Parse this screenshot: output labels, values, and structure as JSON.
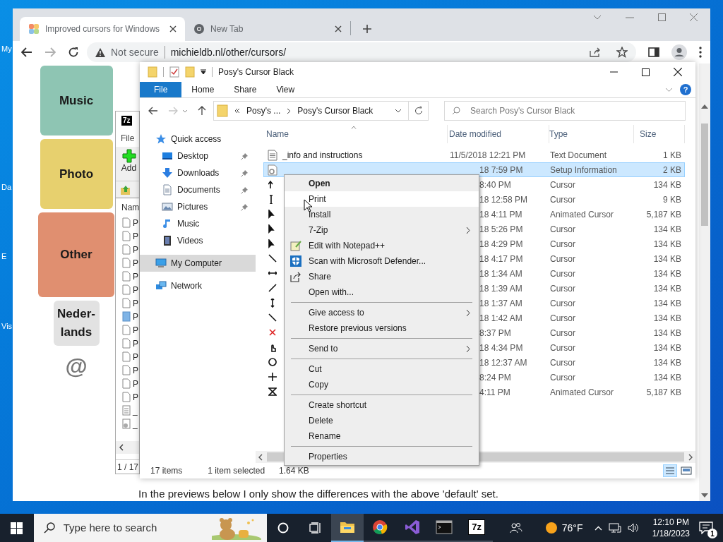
{
  "desktop_icons": [
    {
      "label": "My"
    },
    {
      "label": "Da"
    },
    {
      "label": "E"
    },
    {
      "label": "Vis"
    }
  ],
  "browser": {
    "tabs": [
      {
        "title": "Improved cursors for Windows",
        "selected": true
      },
      {
        "title": "New Tab",
        "selected": false
      }
    ],
    "security": "Not secure",
    "url": "michieldb.nl/other/cursors/"
  },
  "page": {
    "tiles": [
      {
        "label": "Music",
        "color": "#8ec5b3"
      },
      {
        "label": "Photo",
        "color": "#e7d06e"
      },
      {
        "label": "Other",
        "color": "#e08f70"
      },
      {
        "label": "Neder-lands",
        "color": "#e2e2e2"
      }
    ],
    "at": "@",
    "text": "In the previews below I only show the differences with the above 'default' set."
  },
  "sevenzip": {
    "logo": "7z",
    "menu": "File",
    "add": "Add",
    "column": "Nam",
    "rows": [
      {
        "name": "P",
        "kind": "file"
      },
      {
        "name": "P",
        "kind": "file"
      },
      {
        "name": "P",
        "kind": "file"
      },
      {
        "name": "P",
        "kind": "file"
      },
      {
        "name": "P",
        "kind": "file"
      },
      {
        "name": "P",
        "kind": "file"
      },
      {
        "name": "P",
        "kind": "file"
      },
      {
        "name": "P",
        "kind": "marked"
      },
      {
        "name": "P",
        "kind": "file"
      },
      {
        "name": "P",
        "kind": "file"
      },
      {
        "name": "P",
        "kind": "file"
      },
      {
        "name": "P",
        "kind": "file"
      },
      {
        "name": "P",
        "kind": "file"
      },
      {
        "name": "P",
        "kind": "file"
      },
      {
        "name": "_",
        "kind": "text"
      },
      {
        "name": "_",
        "kind": "setup"
      }
    ],
    "status": "1 / 17"
  },
  "explorer": {
    "title": "Posy's Cursor Black",
    "ribbon_tabs": [
      {
        "label": "File",
        "selected": true
      },
      {
        "label": "Home",
        "selected": false
      },
      {
        "label": "Share",
        "selected": false
      },
      {
        "label": "View",
        "selected": false
      }
    ],
    "help": "?",
    "breadcrumbs": [
      "Posy's ...",
      "Posy's Cursor Black"
    ],
    "search_placeholder": "Search Posy's Cursor Black",
    "nav": [
      {
        "label": "Quick access",
        "selected": false,
        "children": [
          {
            "label": "Desktop",
            "pinned": true,
            "selected": false
          },
          {
            "label": "Downloads",
            "pinned": true,
            "selected": false
          },
          {
            "label": "Documents",
            "pinned": true,
            "selected": false
          },
          {
            "label": "Pictures",
            "pinned": true,
            "selected": false
          },
          {
            "label": "Music",
            "pinned": false,
            "selected": false
          },
          {
            "label": "Videos",
            "pinned": false,
            "selected": false
          }
        ]
      },
      {
        "label": "My Computer",
        "selected": true
      },
      {
        "label": "Network",
        "selected": false
      }
    ],
    "columns": [
      "Name",
      "Date modified",
      "Type",
      "Size"
    ],
    "rows": [
      {
        "kind": "text",
        "name": "_info and instructions",
        "date": "11/5/2018 12:21 PM",
        "type": "Text Document",
        "size": "1 KB",
        "selected": false,
        "covered": false
      },
      {
        "kind": "setup",
        "date": "18 7:59 PM",
        "type": "Setup Information",
        "size": "2 KB",
        "selected": true,
        "covered": true
      },
      {
        "kind": "cursor",
        "date": "8:40 PM",
        "type": "Cursor",
        "size": "134 KB",
        "selected": false,
        "covered": true
      },
      {
        "kind": "cursor",
        "date": "18 12:58 PM",
        "type": "Cursor",
        "size": "9 KB",
        "selected": false,
        "covered": true
      },
      {
        "kind": "cursor",
        "date": "18 4:11 PM",
        "type": "Animated Cursor",
        "size": "5,187 KB",
        "selected": false,
        "covered": true
      },
      {
        "kind": "cursor",
        "date": "18 5:26 PM",
        "type": "Cursor",
        "size": "134 KB",
        "selected": false,
        "covered": true
      },
      {
        "kind": "cursor",
        "date": "18 4:29 PM",
        "type": "Cursor",
        "size": "134 KB",
        "selected": false,
        "covered": true
      },
      {
        "kind": "cursor",
        "date": "18 4:17 PM",
        "type": "Cursor",
        "size": "134 KB",
        "selected": false,
        "covered": true
      },
      {
        "kind": "cursor",
        "date": "18 1:34 AM",
        "type": "Cursor",
        "size": "134 KB",
        "selected": false,
        "covered": true
      },
      {
        "kind": "cursor",
        "date": "18 1:39 AM",
        "type": "Cursor",
        "size": "134 KB",
        "selected": false,
        "covered": true
      },
      {
        "kind": "cursor",
        "date": "18 1:37 AM",
        "type": "Cursor",
        "size": "134 KB",
        "selected": false,
        "covered": true
      },
      {
        "kind": "cursor",
        "date": "18 1:42 AM",
        "type": "Cursor",
        "size": "134 KB",
        "selected": false,
        "covered": true
      },
      {
        "kind": "cursor",
        "date": "8:37 PM",
        "type": "Cursor",
        "size": "134 KB",
        "selected": false,
        "covered": true
      },
      {
        "kind": "cursor",
        "date": "18 4:34 PM",
        "type": "Cursor",
        "size": "134 KB",
        "selected": false,
        "covered": true
      },
      {
        "kind": "cursor",
        "date": "18 12:37 AM",
        "type": "Cursor",
        "size": "134 KB",
        "selected": false,
        "covered": true
      },
      {
        "kind": "cursor",
        "date": "8:24 PM",
        "type": "Cursor",
        "size": "134 KB",
        "selected": false,
        "covered": true
      },
      {
        "kind": "cursor",
        "date": "4:11 PM",
        "type": "Animated Cursor",
        "size": "5,187 KB",
        "selected": false,
        "covered": true
      }
    ],
    "status": [
      "17 items",
      "1 item selected",
      "1.64 KB"
    ]
  },
  "context_menu": [
    {
      "kind": "item",
      "label": "Open",
      "bold": true,
      "highlighted": false,
      "submenu": false
    },
    {
      "kind": "item",
      "label": "Print",
      "bold": false,
      "highlighted": true,
      "submenu": false
    },
    {
      "kind": "item",
      "label": "Install",
      "bold": false,
      "highlighted": false,
      "submenu": false
    },
    {
      "kind": "item",
      "label": "7-Zip",
      "bold": false,
      "highlighted": false,
      "submenu": true
    },
    {
      "kind": "item",
      "label": "Edit with Notepad++",
      "bold": false,
      "highlighted": false,
      "submenu": false
    },
    {
      "kind": "item",
      "label": "Scan with Microsoft Defender...",
      "bold": false,
      "highlighted": false,
      "submenu": false
    },
    {
      "kind": "item",
      "label": "Share",
      "bold": false,
      "highlighted": false,
      "submenu": false
    },
    {
      "kind": "item",
      "label": "Open with...",
      "bold": false,
      "highlighted": false,
      "submenu": false
    },
    {
      "kind": "separator"
    },
    {
      "kind": "item",
      "label": "Give access to",
      "bold": false,
      "highlighted": false,
      "submenu": true
    },
    {
      "kind": "item",
      "label": "Restore previous versions",
      "bold": false,
      "highlighted": false,
      "submenu": false
    },
    {
      "kind": "separator"
    },
    {
      "kind": "item",
      "label": "Send to",
      "bold": false,
      "highlighted": false,
      "submenu": true
    },
    {
      "kind": "separator"
    },
    {
      "kind": "item",
      "label": "Cut",
      "bold": false,
      "highlighted": false,
      "submenu": false
    },
    {
      "kind": "item",
      "label": "Copy",
      "bold": false,
      "highlighted": false,
      "submenu": false
    },
    {
      "kind": "separator"
    },
    {
      "kind": "item",
      "label": "Create shortcut",
      "bold": false,
      "highlighted": false,
      "submenu": false
    },
    {
      "kind": "item",
      "label": "Delete",
      "bold": false,
      "highlighted": false,
      "submenu": false
    },
    {
      "kind": "item",
      "label": "Rename",
      "bold": false,
      "highlighted": false,
      "submenu": false
    },
    {
      "kind": "separator"
    },
    {
      "kind": "item",
      "label": "Properties",
      "bold": false,
      "highlighted": false,
      "submenu": false
    }
  ],
  "taskbar": {
    "search_placeholder": "Type here to search",
    "apps": [
      {
        "kind": "explorer",
        "active": true
      },
      {
        "kind": "chrome",
        "active": false
      },
      {
        "kind": "vs",
        "active": false
      },
      {
        "kind": "terminal",
        "active": false
      },
      {
        "kind": "sevenzip",
        "label": "7z",
        "active": false
      }
    ],
    "weather": "76°F",
    "time": "12:10 PM",
    "date": "1/18/2023",
    "notifications": "1"
  }
}
